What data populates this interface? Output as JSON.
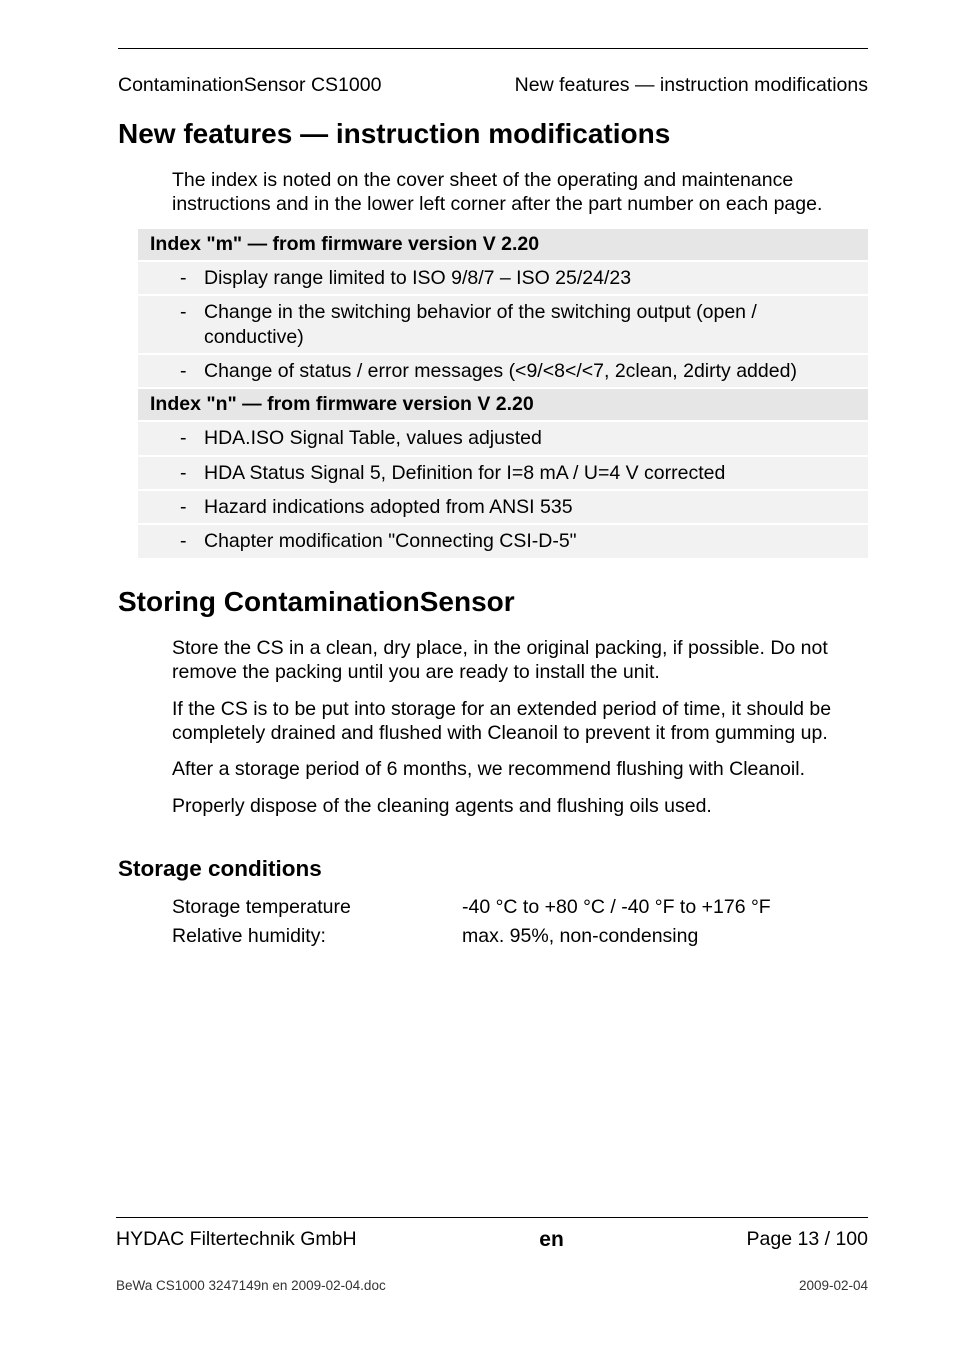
{
  "header": {
    "left": "ContaminationSensor CS1000",
    "right": "New features — instruction modifications"
  },
  "section1": {
    "title": "New features — instruction modifications",
    "intro": "The index is noted on the cover sheet of the operating and maintenance instructions and in the lower left corner after the part number on each page.",
    "group_m": {
      "head": "Index \"m\" — from firmware version V 2.20",
      "items": [
        "Display range limited to ISO 9/8/7 – ISO 25/24/23",
        "Change in the switching behavior of the switching output (open / conductive)",
        "Change of status / error messages (<9/<8</<7, 2clean, 2dirty added)"
      ]
    },
    "group_n": {
      "head": "Index \"n\" — from firmware version V 2.20",
      "items": [
        "HDA.ISO Signal Table, values adjusted",
        "HDA Status Signal 5, Definition for I=8 mA / U=4 V corrected",
        "Hazard indications adopted from ANSI 535",
        "Chapter modification \"Connecting CSI-D-5\""
      ]
    }
  },
  "section2": {
    "title": "Storing ContaminationSensor",
    "p1": "Store the CS in a clean, dry place, in the original packing, if possible. Do not remove the packing until you are ready to install the unit.",
    "p2": "If the CS is to be put into storage for an extended period of time, it should be completely drained and flushed with Cleanoil to prevent it from gumming up.",
    "p3": "After a storage period of 6 months, we recommend flushing with Cleanoil.",
    "p4": "Properly dispose of the cleaning agents and flushing oils used."
  },
  "section3": {
    "title": "Storage conditions",
    "rows": [
      {
        "k": "Storage temperature",
        "v": "-40 °C to +80 °C / -40 °F to +176 °F"
      },
      {
        "k": "Relative humidity:",
        "v": "max. 95%, non-condensing"
      }
    ]
  },
  "footer": {
    "left": "HYDAC Filtertechnik GmbH",
    "mid": "en",
    "right": "Page 13 / 100",
    "small_left": "BeWa CS1000 3247149n en 2009-02-04.doc",
    "small_right": "2009-02-04"
  }
}
